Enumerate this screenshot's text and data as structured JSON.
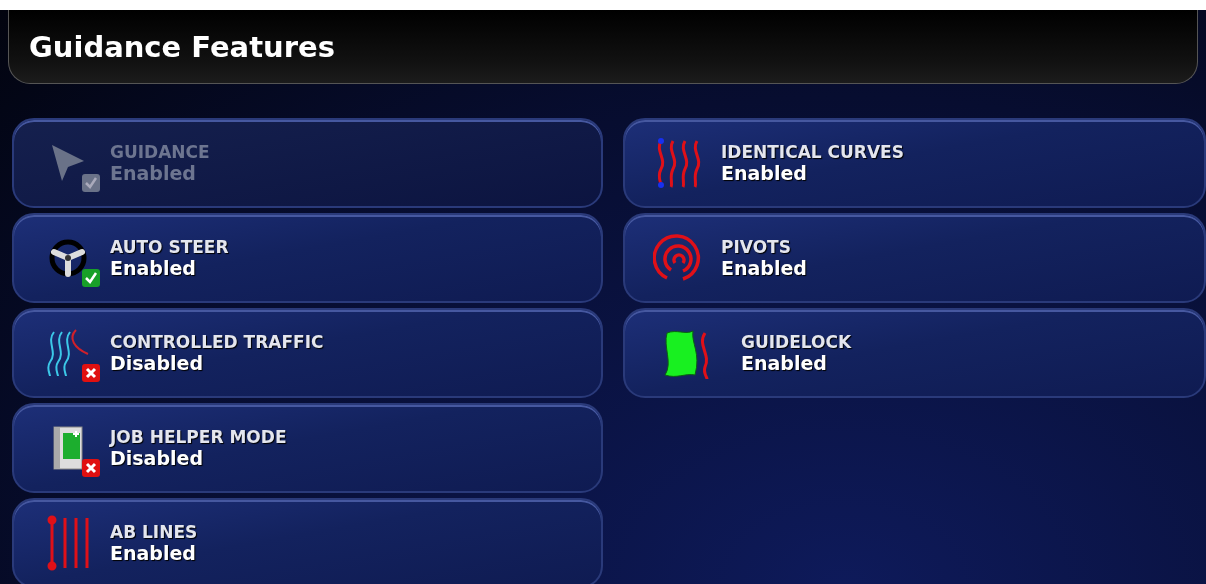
{
  "title": "Guidance Features",
  "columns": [
    {
      "tiles": [
        {
          "kind": "guidance",
          "label": "GUIDANCE",
          "status": "Enabled",
          "disabled": true,
          "checked": true
        },
        {
          "kind": "steer",
          "label": "AUTO STEER",
          "status": "Enabled",
          "disabled": false,
          "checked": true
        },
        {
          "kind": "traffic",
          "label": "CONTROLLED TRAFFIC",
          "status": "Disabled",
          "disabled": false,
          "checked": false
        },
        {
          "kind": "job",
          "label": "JOB HELPER MODE",
          "status": "Disabled",
          "disabled": false,
          "checked": false
        },
        {
          "kind": "ablines",
          "label": "AB LINES",
          "status": "Enabled",
          "disabled": false
        }
      ]
    },
    {
      "tiles": [
        {
          "kind": "curves",
          "label": "IDENTICAL CURVES",
          "status": "Enabled",
          "disabled": false
        },
        {
          "kind": "pivots",
          "label": "PIVOTS",
          "status": "Enabled",
          "disabled": false
        },
        {
          "kind": "guidelock",
          "label": "GUIDELOCK",
          "status": "Enabled",
          "disabled": false
        }
      ]
    }
  ]
}
